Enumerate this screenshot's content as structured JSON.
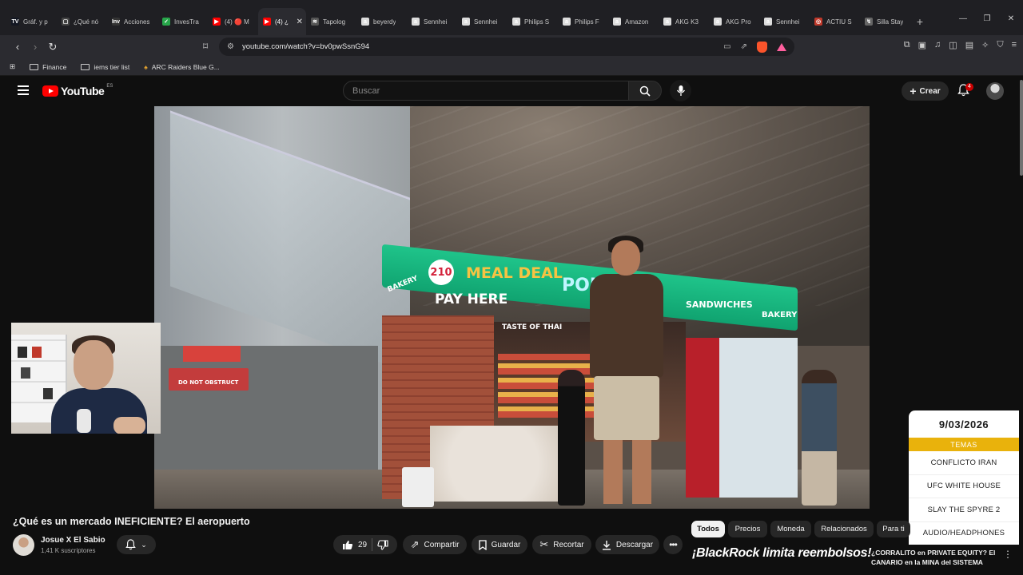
{
  "browser": {
    "tabs": [
      {
        "label": "Gráf. y p",
        "fav": "TV",
        "color": "#131722"
      },
      {
        "label": "¿Qué nó",
        "fav": "▢",
        "color": "#444"
      },
      {
        "label": "Acciones",
        "fav": "Inv",
        "color": "#333"
      },
      {
        "label": "InvesTra",
        "fav": "✓",
        "color": "#27a64a"
      },
      {
        "label": "(4) 🔴 M",
        "fav": "▶",
        "color": "#ff0000"
      },
      {
        "label": "(4) ¿",
        "fav": "▶",
        "color": "#ff0000"
      },
      {
        "label": "Tapolog",
        "fav": "≋",
        "color": "#555"
      },
      {
        "label": "beyerdy",
        "fav": "a",
        "color": "#ddd"
      },
      {
        "label": "Sennhei",
        "fav": "a",
        "color": "#ddd"
      },
      {
        "label": "Sennhei",
        "fav": "a",
        "color": "#ddd"
      },
      {
        "label": "Philips S",
        "fav": "a",
        "color": "#ddd"
      },
      {
        "label": "Philips F",
        "fav": "a",
        "color": "#ddd"
      },
      {
        "label": "Amazon",
        "fav": "a",
        "color": "#ddd"
      },
      {
        "label": "AKG K3",
        "fav": "a",
        "color": "#ddd"
      },
      {
        "label": "AKG Pro",
        "fav": "a",
        "color": "#ddd"
      },
      {
        "label": "Sennhei",
        "fav": "a",
        "color": "#ddd"
      },
      {
        "label": "ACTIU S",
        "fav": "◎",
        "color": "#c0392b"
      },
      {
        "label": "Silla Stay",
        "fav": "↯",
        "color": "#666"
      }
    ],
    "active_tab_index": 5,
    "url": "youtube.com/watch?v=bv0pwSsnG94",
    "bookmarks": [
      {
        "label": "Finance"
      },
      {
        "label": "iems tier list"
      },
      {
        "label": "ARC Raiders Blue G..."
      }
    ]
  },
  "youtube": {
    "logo_text": "YouTube",
    "country_code": "ES",
    "search_placeholder": "Buscar",
    "create_label": "Crear",
    "notification_count": "4"
  },
  "video": {
    "sign_price": "210",
    "sign_meal": "MEAL DEAL",
    "sign_point": "POI",
    "sign_pay": "PAY HERE",
    "sign_sandwiches": "SANDWICHES",
    "sign_bakery": "BAKERY",
    "sign_taste": "TASTE OF THAI",
    "sign_do_not_obstruct": "DO NOT OBSTRUCT"
  },
  "overlay": {
    "date": "9/03/2026",
    "temas_label": "TEMAS",
    "topics": [
      "CONFLICTO IRAN",
      "UFC WHITE HOUSE",
      "SLAY THE SPYRE 2",
      "AUDIO/HEADPHONES"
    ]
  },
  "watch": {
    "title": "¿Qué es un mercado INEFICIENTE? El aeropuerto",
    "channel": "Josue X El Sabio",
    "subscribers": "1,41 K suscriptores",
    "likes": "29",
    "share_label": "Compartir",
    "save_label": "Guardar",
    "clip_label": "Recortar",
    "download_label": "Descargar"
  },
  "chips": [
    "Todos",
    "Precios",
    "Moneda",
    "Relacionados",
    "Para ti"
  ],
  "recommendation": {
    "thumbnail_text": "¡BlackRock limita reembolsos!",
    "title": "¿CORRALITO en PRIVATE EQUITY? El CANARIO en la MINA del SISTEMA"
  }
}
